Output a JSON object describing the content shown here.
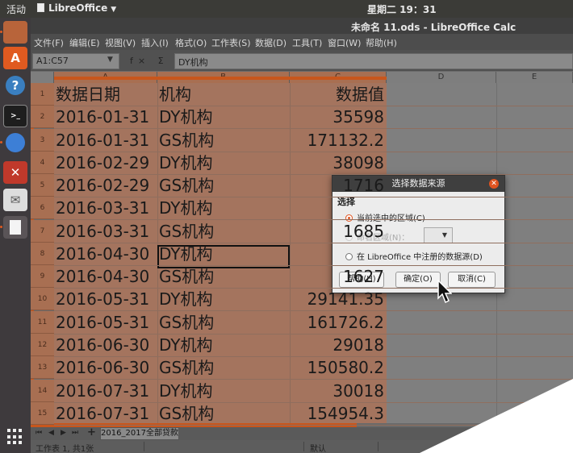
{
  "topbar": {
    "activities": "活动",
    "app_name": "LibreOffice",
    "clock": "星期二 19：31"
  },
  "window": {
    "title": "未命名 11.ods - LibreOffice Calc"
  },
  "menu": [
    "文件(F)",
    "编辑(E)",
    "视图(V)",
    "插入(I)",
    "格式(O)",
    "工作表(S)",
    "数据(D)",
    "工具(T)",
    "窗口(W)",
    "帮助(H)"
  ],
  "formula_bar": {
    "name_box": "A1:C57",
    "fx_icons": "f× Σ =",
    "content": "DY机构"
  },
  "columns": [
    "A",
    "B",
    "C",
    "D",
    "E"
  ],
  "rows": [
    {
      "n": "1",
      "a": "数据日期",
      "b": "机构",
      "c": "数据值"
    },
    {
      "n": "2",
      "a": "2016-01-31",
      "b": "DY机构",
      "c": "35598"
    },
    {
      "n": "3",
      "a": "2016-01-31",
      "b": "GS机构",
      "c": "171132.2"
    },
    {
      "n": "4",
      "a": "2016-02-29",
      "b": "DY机构",
      "c": "38098"
    },
    {
      "n": "5",
      "a": "2016-02-29",
      "b": "GS机构",
      "c": "1716"
    },
    {
      "n": "6",
      "a": "2016-03-31",
      "b": "DY机构",
      "c": ""
    },
    {
      "n": "7",
      "a": "2016-03-31",
      "b": "GS机构",
      "c": "1685"
    },
    {
      "n": "8",
      "a": "2016-04-30",
      "b": "DY机构",
      "c": ""
    },
    {
      "n": "9",
      "a": "2016-04-30",
      "b": "GS机构",
      "c": "1627"
    },
    {
      "n": "10",
      "a": "2016-05-31",
      "b": "DY机构",
      "c": "29141.35"
    },
    {
      "n": "11",
      "a": "2016-05-31",
      "b": "GS机构",
      "c": "161726.2"
    },
    {
      "n": "12",
      "a": "2016-06-30",
      "b": "DY机构",
      "c": "29018"
    },
    {
      "n": "13",
      "a": "2016-06-30",
      "b": "GS机构",
      "c": "150580.2"
    },
    {
      "n": "14",
      "a": "2016-07-31",
      "b": "DY机构",
      "c": "30018"
    },
    {
      "n": "15",
      "a": "2016-07-31",
      "b": "GS机构",
      "c": "154954.3"
    }
  ],
  "sheet_tab": "2016_2017全部贷款",
  "status": {
    "sheet_info": "工作表 1, 共1张",
    "page_style": "默认"
  },
  "dialog": {
    "title": "选择数据来源",
    "group_label": "选择",
    "option_current": "当前选中的区域(C)",
    "option_named": "命名区域(N)：",
    "option_registered": "在 LibreOffice 中注册的数据源(D)",
    "selected_option": "current",
    "help_button": "帮助(H)",
    "ok_button": "确定(O)",
    "cancel_button": "取消(C)"
  },
  "colors": {
    "selection": "#a4745e",
    "accent": "#c8561c",
    "close_button": "#e0531f"
  }
}
